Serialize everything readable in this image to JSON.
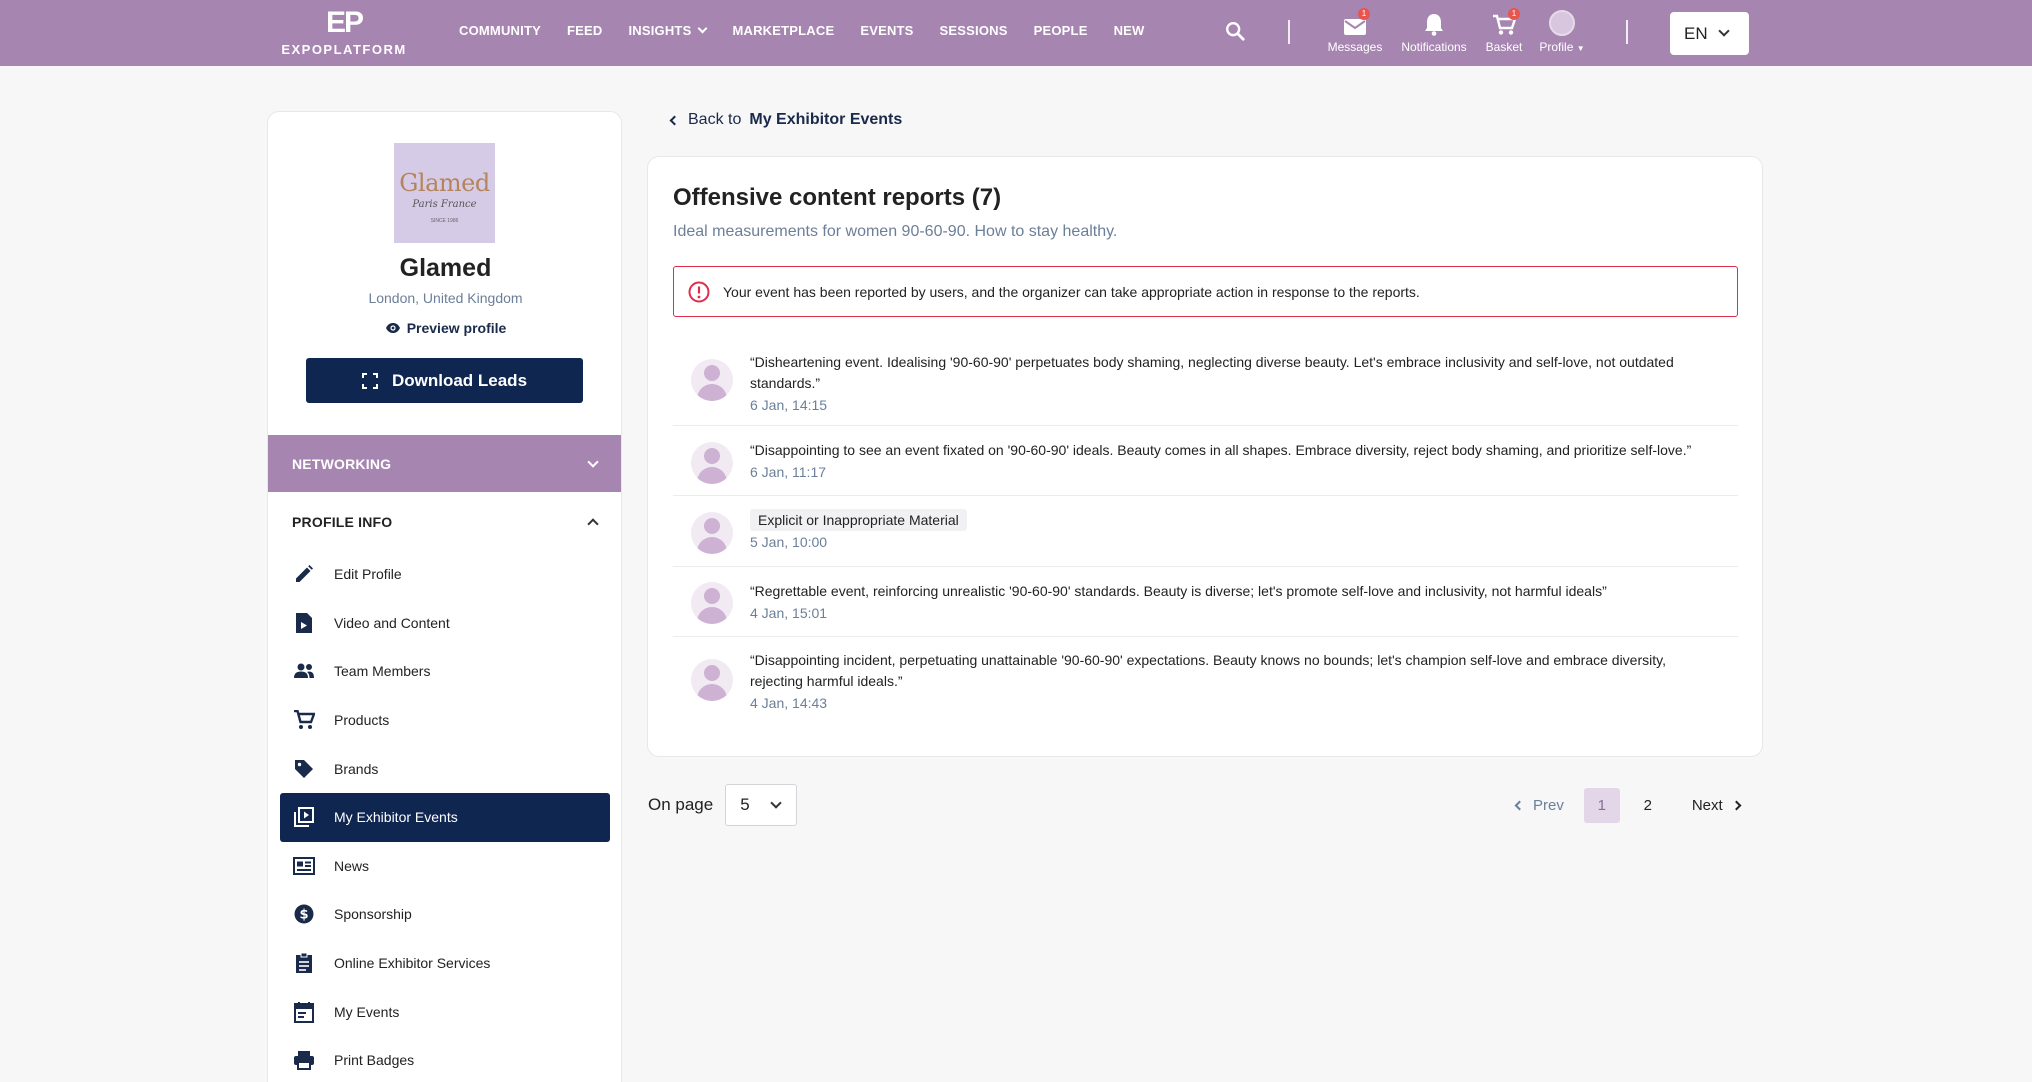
{
  "header": {
    "logo_mark": "EP",
    "logo_text": "EXPOPLATFORM",
    "nav": [
      "COMMUNITY",
      "FEED",
      "INSIGHTS",
      "MARKETPLACE",
      "EVENTS",
      "SESSIONS",
      "PEOPLE",
      "NEW"
    ],
    "messages": {
      "label": "Messages",
      "count": "1"
    },
    "notifications": {
      "label": "Notifications"
    },
    "basket": {
      "label": "Basket",
      "count": "1"
    },
    "profile": {
      "label": "Profile"
    },
    "language": "EN",
    "colors": {
      "bar": "#a785b1",
      "badge": "#e8554e"
    }
  },
  "sidebar": {
    "logo": {
      "word": "Glamed",
      "script": "Paris France",
      "since": "SINCE 1986"
    },
    "company_name": "Glamed",
    "location": "London, United Kingdom",
    "preview_label": "Preview profile",
    "download_label": "Download Leads",
    "networking_label": "NETWORKING",
    "profile_info_label": "PROFILE INFO",
    "menu": [
      {
        "label": "Edit Profile",
        "icon": "pencil-icon"
      },
      {
        "label": "Video and Content",
        "icon": "video-file-icon"
      },
      {
        "label": "Team Members",
        "icon": "people-icon"
      },
      {
        "label": "Products",
        "icon": "cart-icon"
      },
      {
        "label": "Brands",
        "icon": "tag-icon"
      },
      {
        "label": "My Exhibitor Events",
        "icon": "play-library-icon",
        "active": true
      },
      {
        "label": "News",
        "icon": "news-icon"
      },
      {
        "label": "Sponsorship",
        "icon": "dollar-icon"
      },
      {
        "label": "Online Exhibitor Services",
        "icon": "clipboard-icon"
      },
      {
        "label": "My Events",
        "icon": "calendar-icon"
      },
      {
        "label": "Print Badges",
        "icon": "printer-icon"
      }
    ],
    "colors": {
      "primary": "#0f2651",
      "accent": "#a785b1"
    }
  },
  "main": {
    "back_prefix": "Back to",
    "back_target": "My Exhibitor Events",
    "title": "Offensive content reports (7)",
    "subtitle": "Ideal measurements for women 90-60-90. How to stay healthy.",
    "alert": "Your event has been reported by users, and the organizer can take appropriate action in response to the reports.",
    "reports": [
      {
        "text": "“Disheartening event. Idealising '90-60-90' perpetuates body shaming, neglecting diverse beauty. Let's embrace inclusivity and self-love, not outdated standards.”",
        "date": "6 Jan, 14:15"
      },
      {
        "text": "“Disappointing to see an event fixated on '90-60-90' ideals. Beauty comes in all shapes. Embrace diversity, reject body shaming, and prioritize self-love.”",
        "date": "6 Jan, 11:17"
      },
      {
        "tag": "Explicit or Inappropriate Material",
        "date": "5 Jan, 10:00"
      },
      {
        "text": "“Regrettable event, reinforcing unrealistic '90-60-90' standards. Beauty is diverse; let's promote self-love and inclusivity, not harmful ideals”",
        "date": "4 Jan, 15:01"
      },
      {
        "text": "“Disappointing incident, perpetuating unattainable '90-60-90' expectations. Beauty knows no bounds; let's champion self-love and embrace diversity, rejecting harmful ideals.”",
        "date": "4 Jan, 14:43"
      }
    ],
    "pagination": {
      "on_page_label": "On page",
      "per_page": "5",
      "prev": "Prev",
      "pages": [
        "1",
        "2"
      ],
      "current": "1",
      "next": "Next"
    },
    "colors": {
      "alert_border": "#e02b4a",
      "muted": "#6c7f99"
    }
  }
}
